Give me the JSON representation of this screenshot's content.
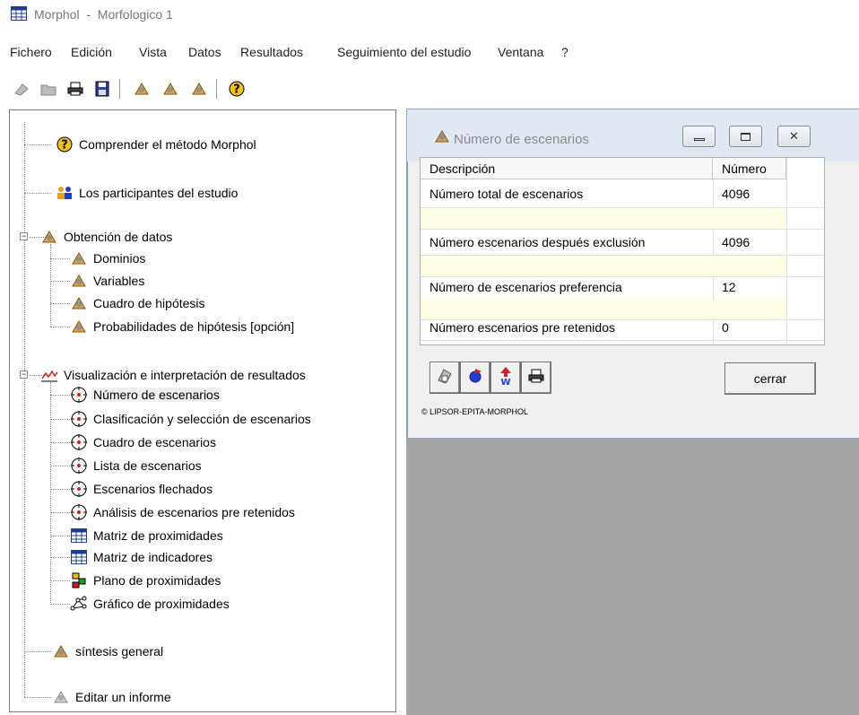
{
  "window": {
    "title": "Morphol  -  Morfologico 1"
  },
  "menu": [
    "Fichero",
    "Edición",
    "Vista",
    "Datos",
    "Resultados",
    "Seguimiento del estudio",
    "Ventana",
    "?"
  ],
  "tree": {
    "understand": "Comprender el método Morphol",
    "participants": "Los participantes del estudio",
    "data_collection": {
      "label": "Obtención de datos",
      "children": [
        "Dominios",
        "Variables",
        "Cuadro de hipótesis",
        "Probabilidades de hipótesis [opción]"
      ]
    },
    "visualization": {
      "label": "Visualización e interpretación de resultados",
      "children": [
        "Número de escenarios",
        "Clasificación y selección de escenarios",
        "Cuadro de escenarios",
        "Lista de escenarios",
        "Escenarios flechados",
        "Análisis de escenarios pre retenidos",
        "Matriz de proximidades",
        "Matriz de indicadores",
        "Plano de proximidades",
        "Gráfico de proximidades"
      ]
    },
    "synthesis": "síntesis general",
    "report": "Editar un informe"
  },
  "child_window": {
    "title": "Número de escenarios",
    "columns": [
      "Descripción",
      "Número"
    ],
    "rows": [
      {
        "description": "Número total de escenarios",
        "value": "4096"
      },
      {
        "description": "",
        "value": ""
      },
      {
        "description": "Número escenarios después exclusión",
        "value": "4096"
      },
      {
        "description": "",
        "value": ""
      },
      {
        "description": "Número de escenarios preferencia",
        "value": "12"
      },
      {
        "description": "",
        "value": ""
      },
      {
        "description": "Número escenarios pre retenidos",
        "value": "0"
      }
    ],
    "close_label": "cerrar",
    "copyright": "© LIPSOR-EPITA-MORPHOL"
  }
}
